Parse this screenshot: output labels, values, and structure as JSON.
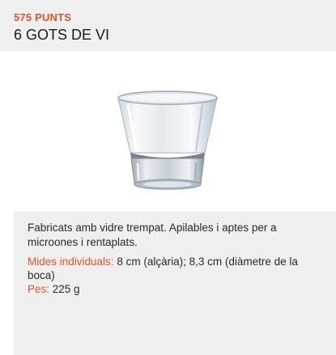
{
  "header": {
    "points": "575 PUNTS",
    "title": "6 GOTS DE VI"
  },
  "product_image": {
    "icon": "wine-glass-icon"
  },
  "details": {
    "description": "Fabricats amb vidre trempat. Apilables i aptes per a microones i rentaplats.",
    "size_label": "Mides individuals:",
    "size_value": " 8 cm (alçària); 8,3 cm (diàmetre de la boca)",
    "weight_label": "Pes:",
    "weight_value": " 225 g"
  },
  "colors": {
    "accent": "#e8542b",
    "panel": "#efefef",
    "text": "#1c1c1c"
  }
}
